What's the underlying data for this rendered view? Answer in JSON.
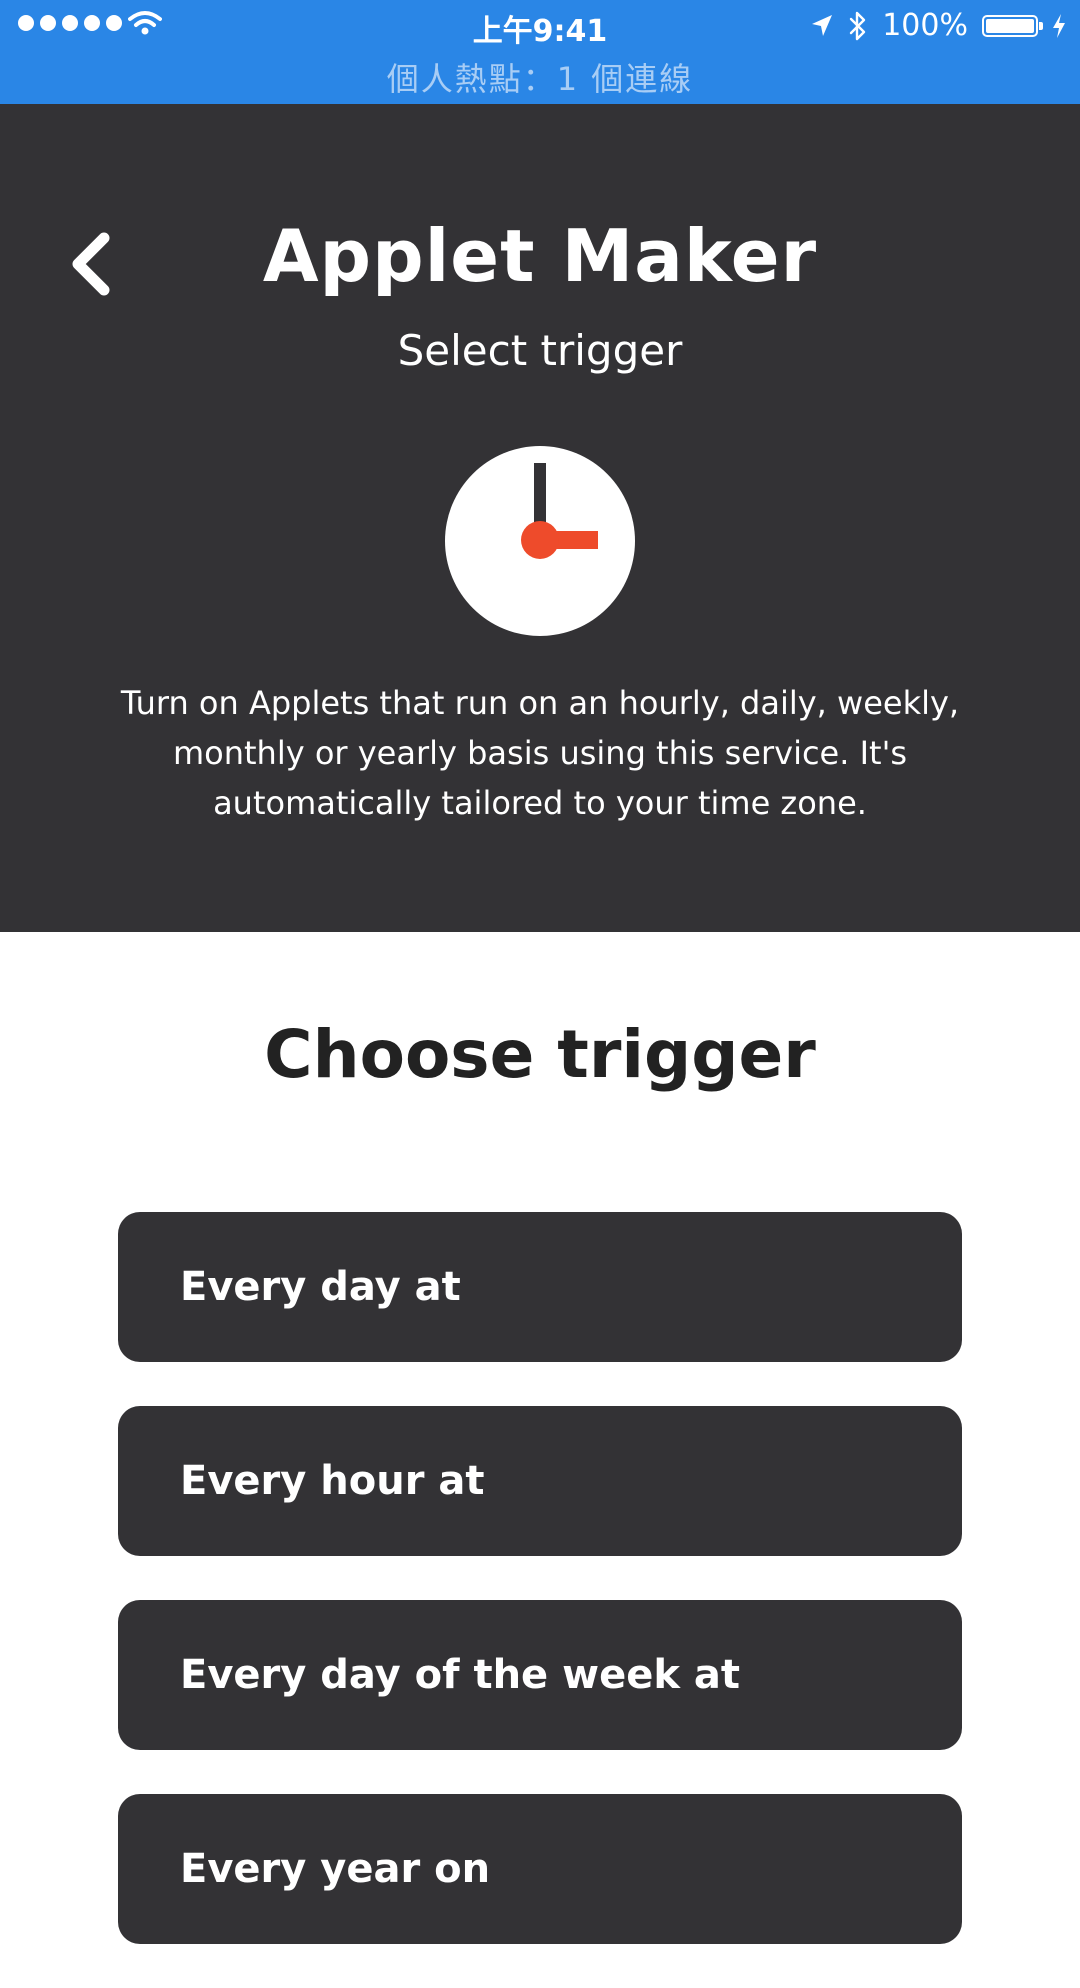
{
  "status_bar": {
    "time": "上午9:41",
    "battery_text": "100%",
    "battery_level": 1.0,
    "hotspot_text": "個人熱點：1 個連線"
  },
  "header": {
    "title": "Applet Maker",
    "subtitle": "Select trigger",
    "description": "Turn on Applets that run on an hourly, daily, weekly, monthly or yearly basis using this service. It's automatically tailored to your time zone.",
    "background_color": "#333235",
    "accent_color": "#ee4b2b"
  },
  "main": {
    "heading": "Choose trigger",
    "triggers": [
      {
        "label": "Every day at"
      },
      {
        "label": "Every hour at"
      },
      {
        "label": "Every day of the week at"
      },
      {
        "label": "Every year on"
      }
    ]
  },
  "icons": {
    "back": "chevron-left-icon",
    "service": "clock-icon",
    "wifi": "wifi-icon",
    "location": "location-arrow-icon",
    "bluetooth": "bluetooth-icon",
    "battery": "battery-icon",
    "charging": "charging-bolt-icon"
  },
  "status_bar_color": "#2a86e6"
}
